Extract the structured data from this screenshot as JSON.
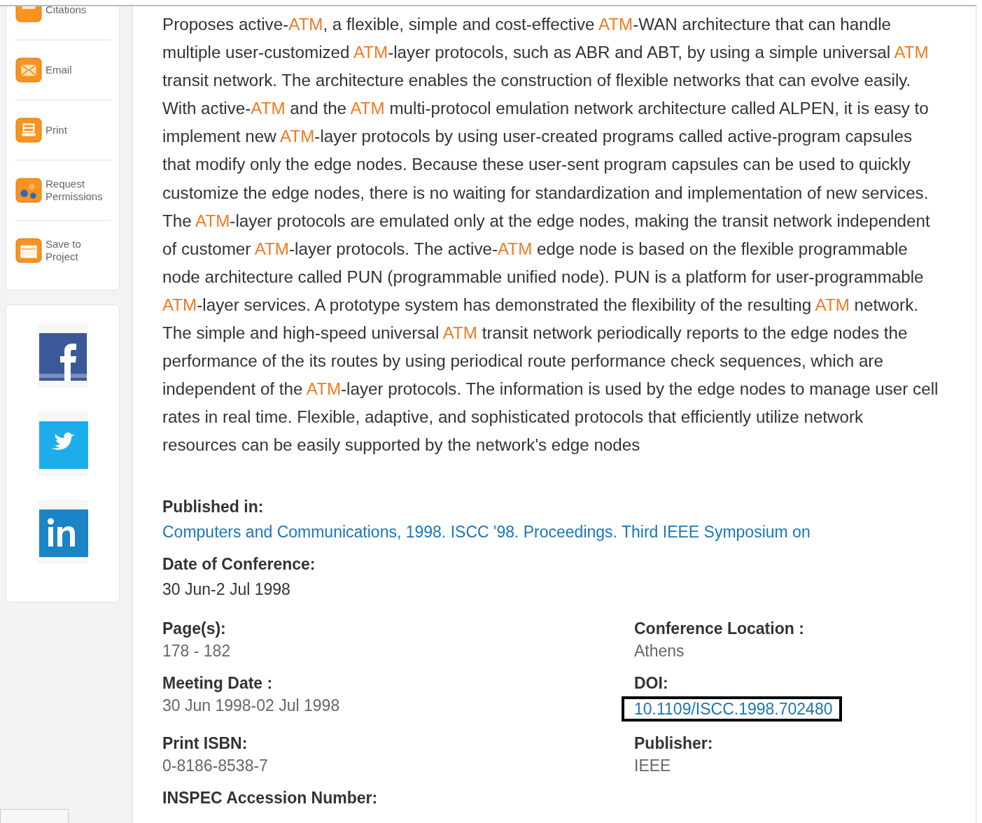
{
  "sidebar": {
    "actions": [
      {
        "kind": "citations",
        "label": "Citations"
      },
      {
        "kind": "email",
        "label": "Email"
      },
      {
        "kind": "print",
        "label": "Print"
      },
      {
        "kind": "permissions",
        "label": "Request Permissions"
      },
      {
        "kind": "project",
        "label": "Save to Project"
      }
    ],
    "social": [
      {
        "kind": "facebook"
      },
      {
        "kind": "twitter"
      },
      {
        "kind": "linkedin"
      }
    ]
  },
  "abstract": {
    "lines": [
      [
        {
          "t": "Proposes active-"
        },
        {
          "t": "ATM",
          "hl": true
        },
        {
          "t": ", a flexible, simple and cost-effective "
        },
        {
          "t": "ATM",
          "hl": true
        },
        {
          "t": "-WAN architecture that can handle"
        }
      ],
      [
        {
          "t": "multiple user-customized "
        },
        {
          "t": "ATM",
          "hl": true
        },
        {
          "t": "-layer protocols, such as ABR and ABT, by using a simple universal "
        },
        {
          "t": "ATM",
          "hl": true
        }
      ],
      [
        {
          "t": "transit network. The architecture enables the construction of flexible networks that can evolve easily."
        }
      ],
      [
        {
          "t": "With active-"
        },
        {
          "t": "ATM",
          "hl": true
        },
        {
          "t": " and the "
        },
        {
          "t": "ATM",
          "hl": true
        },
        {
          "t": " multi-protocol emulation network architecture called ALPEN, it is easy to"
        }
      ],
      [
        {
          "t": "implement new "
        },
        {
          "t": "ATM",
          "hl": true
        },
        {
          "t": "-layer protocols by using user-created programs called active-program capsules"
        }
      ],
      [
        {
          "t": "that modify only the edge nodes. Because these user-sent program capsules can be used to quickly"
        }
      ],
      [
        {
          "t": "customize the edge nodes, there is no waiting for standardization and implementation of new services."
        }
      ],
      [
        {
          "t": "The "
        },
        {
          "t": "ATM",
          "hl": true
        },
        {
          "t": "-layer protocols are emulated only at the edge nodes, making the transit network independent"
        }
      ],
      [
        {
          "t": "of customer "
        },
        {
          "t": "ATM",
          "hl": true
        },
        {
          "t": "-layer protocols. The active-"
        },
        {
          "t": "ATM",
          "hl": true
        },
        {
          "t": " edge node is based on the flexible programmable"
        }
      ],
      [
        {
          "t": "node architecture called PUN (programmable unified node). PUN is a platform for user-programmable"
        }
      ],
      [
        {
          "t": "ATM",
          "hl": true
        },
        {
          "t": "-layer services. A prototype system has demonstrated the flexibility of the resulting "
        },
        {
          "t": "ATM",
          "hl": true
        },
        {
          "t": " network."
        }
      ],
      [
        {
          "t": "The simple and high-speed universal "
        },
        {
          "t": "ATM",
          "hl": true
        },
        {
          "t": " transit network periodically reports to the edge nodes the"
        }
      ],
      [
        {
          "t": "performance of the its routes by using periodical route performance check sequences, which are"
        }
      ],
      [
        {
          "t": "independent of the "
        },
        {
          "t": "ATM",
          "hl": true
        },
        {
          "t": "-layer protocols. The information is used by the edge nodes to manage user cell"
        }
      ],
      [
        {
          "t": "rates in real time. Flexible, adaptive, and sophisticated protocols that efficiently utilize network"
        }
      ],
      [
        {
          "t": "resources can be easily supported by the network's edge nodes"
        }
      ]
    ]
  },
  "published_in": {
    "label": "Published in:",
    "value": "Computers and Communications, 1998. ISCC '98. Proceedings. Third IEEE Symposium on"
  },
  "date_of_conference": {
    "label": "Date of Conference:",
    "value": "30 Jun-2 Jul 1998"
  },
  "details": [
    {
      "label": "Page(s):",
      "value": "178 - 182"
    },
    {
      "label": "Conference Location :",
      "value": "Athens"
    },
    {
      "label": "Meeting Date :",
      "value": "30 Jun 1998-02 Jul 1998"
    },
    {
      "label": "DOI:",
      "value": "10.1109/ISCC.1998.702480",
      "link": true,
      "outlined": true
    },
    {
      "label": "Print ISBN:",
      "value": "0-8186-8538-7"
    },
    {
      "label": "Publisher:",
      "value": "IEEE"
    },
    {
      "label": "INSPEC Accession Number:"
    }
  ]
}
